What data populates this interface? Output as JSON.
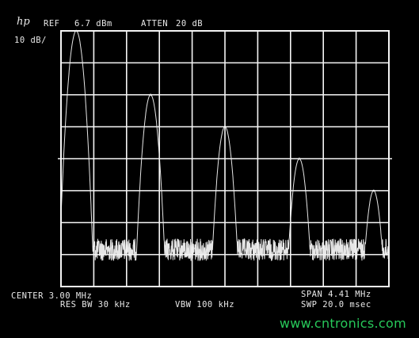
{
  "header": {
    "logo": "hp",
    "ref_label": "REF",
    "ref_value": "6.7 dBm",
    "atten_label": "ATTEN",
    "atten_value": "20 dB",
    "scale": "10 dB/"
  },
  "footer": {
    "center": "CENTER 3.00 MHz",
    "span": "SPAN 4.41 MHz",
    "res_bw": "RES BW 30 kHz",
    "vbw": "VBW 100 kHz",
    "sweep": "SWP 20.0 msec"
  },
  "watermark": "www.cntronics.com",
  "colors": {
    "trace": "#f2f2f2",
    "grid": "#f5f5f5",
    "background": "#000000",
    "watermark": "#27c95a"
  },
  "chart_data": {
    "type": "line",
    "x_axis": {
      "center_mhz": 3.0,
      "span_mhz": 4.41,
      "range_mhz": [
        0.795,
        5.205
      ]
    },
    "y_axis": {
      "reference_dbm": 6.7,
      "scale_db_per_div": 10,
      "divisions": 8,
      "range_dbm": [
        -73.3,
        6.7
      ]
    },
    "grid": true,
    "peaks": [
      {
        "freq_mhz": 1.0,
        "level_dbm": 6.7
      },
      {
        "freq_mhz": 2.0,
        "level_dbm": -13.3
      },
      {
        "freq_mhz": 3.0,
        "level_dbm": -23.3
      },
      {
        "freq_mhz": 4.0,
        "level_dbm": -33.3
      },
      {
        "freq_mhz": 5.0,
        "level_dbm": -43.3
      }
    ],
    "noise_floor_dbm": [
      -58.3,
      -63.3
    ]
  }
}
